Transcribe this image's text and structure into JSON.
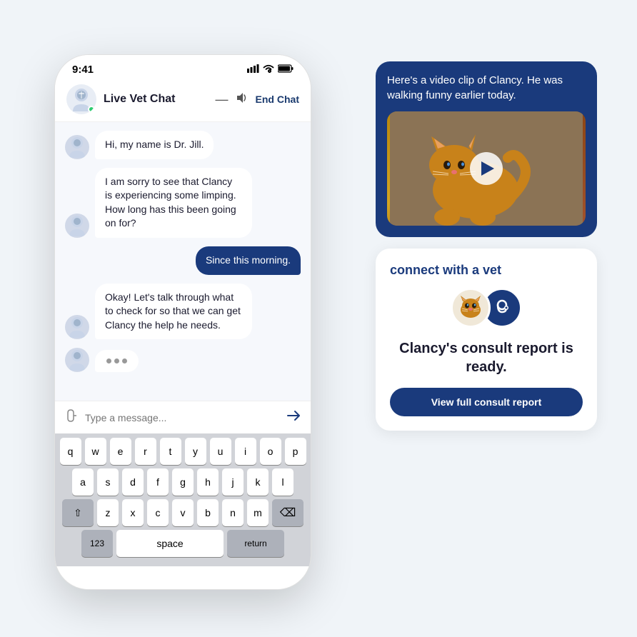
{
  "scene": {
    "background_color": "#f0f4f8"
  },
  "phone": {
    "status_bar": {
      "time": "9:41",
      "signal": "▐▐▐",
      "wifi": "WiFi",
      "battery": "Battery"
    },
    "header": {
      "title": "Live Vet Chat",
      "end_chat_label": "End Chat",
      "minimize_icon": "—",
      "sound_icon": "🔊"
    },
    "messages": [
      {
        "sender": "vet",
        "text": "Hi, my name is Dr. Jill."
      },
      {
        "sender": "vet",
        "text": "I am sorry to see that Clancy is experiencing some limping. How long has this been going on for?"
      },
      {
        "sender": "user",
        "text": "Since this morning."
      },
      {
        "sender": "vet",
        "text": "Okay! Let's talk through what to check for so that we can get Clancy the help he needs."
      },
      {
        "sender": "vet",
        "type": "typing"
      }
    ],
    "input": {
      "placeholder": "Type a message..."
    },
    "keyboard": {
      "rows": [
        [
          "q",
          "w",
          "e",
          "r",
          "t",
          "y",
          "u",
          "i",
          "o",
          "p"
        ],
        [
          "a",
          "s",
          "d",
          "f",
          "g",
          "h",
          "j",
          "k",
          "l"
        ],
        [
          "z",
          "x",
          "c",
          "v",
          "b",
          "n",
          "m"
        ],
        [
          "123",
          "space",
          "return"
        ]
      ]
    }
  },
  "right_panel": {
    "video_card": {
      "message": "Here's a video clip of Clancy. He was walking funny earlier today.",
      "alt_text": "Cat video thumbnail"
    },
    "consult_card": {
      "title": "connect with a vet",
      "report_title": "Clancy's consult report is ready.",
      "button_label": "View full consult report",
      "cat_emoji": "🐱",
      "stethoscope_icon": "🩺"
    }
  }
}
